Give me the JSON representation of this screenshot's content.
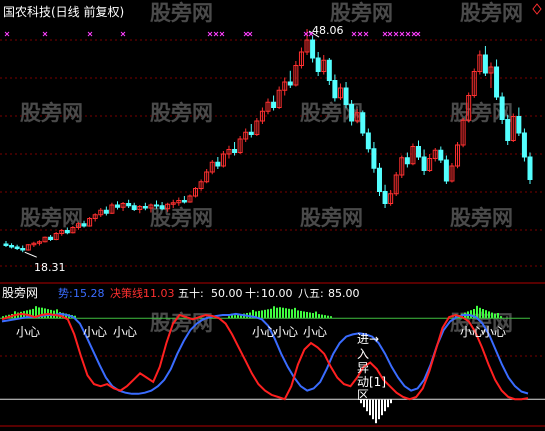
{
  "window": {
    "title": "国农科技(日线 前复权)",
    "corner_icon": "diamond-icon"
  },
  "watermark": "股旁网",
  "price_panel": {
    "high_label": "48.06",
    "low_label": "18.31"
  },
  "indicator_panel": {
    "name": "股旁网",
    "legend": [
      {
        "label": "势:",
        "value": "15.28",
        "color": "#3a6cff"
      },
      {
        "label": "决策线:",
        "value": "11.03",
        "color": "#ff3030"
      },
      {
        "label": "五十:",
        "value": "50.00",
        "color": "#ffffff"
      },
      {
        "label": "十:",
        "value": "10.00",
        "color": "#ffffff"
      },
      {
        "label": "八五:",
        "value": "85.00",
        "color": "#ffffff"
      }
    ],
    "annotations": [
      "小心",
      "小心",
      "小心",
      "小心",
      "小心",
      "小心",
      "小心",
      "小心"
    ],
    "signal_text": [
      "进→",
      "入",
      "异",
      "动[1]",
      "区"
    ]
  },
  "colors": {
    "up": "#ff3030",
    "down": "#54ffff",
    "grid": "#7a0000",
    "blue_line": "#3a6cff",
    "red_line": "#ff2020",
    "green_line": "#40c040",
    "green_bars": "#40ff40",
    "white": "#ffffff",
    "cross": "#ff40ff",
    "label": "#ffffff"
  },
  "chart_data": [
    {
      "type": "candlestick",
      "title": "国农科技(日线 前复权)",
      "y_range_approx": [
        17,
        49
      ],
      "annotated_high": 48.06,
      "annotated_low": 18.31,
      "candles_ohlc": [
        [
          19.4,
          19.8,
          19.0,
          19.2
        ],
        [
          19.2,
          19.5,
          18.8,
          19.0
        ],
        [
          19.0,
          19.3,
          18.6,
          18.8
        ],
        [
          18.8,
          19.2,
          18.31,
          18.6
        ],
        [
          18.6,
          19.4,
          18.5,
          19.3
        ],
        [
          19.3,
          19.7,
          19.0,
          19.5
        ],
        [
          19.5,
          19.9,
          19.2,
          19.7
        ],
        [
          19.7,
          20.4,
          19.6,
          20.3
        ],
        [
          20.3,
          20.6,
          19.8,
          20.0
        ],
        [
          20.0,
          21.0,
          19.9,
          20.8
        ],
        [
          20.8,
          21.4,
          20.5,
          21.2
        ],
        [
          21.2,
          21.6,
          20.7,
          20.9
        ],
        [
          20.9,
          21.8,
          20.8,
          21.6
        ],
        [
          21.6,
          22.3,
          21.3,
          22.1
        ],
        [
          22.1,
          22.5,
          21.6,
          21.8
        ],
        [
          21.8,
          23.0,
          21.7,
          22.8
        ],
        [
          22.8,
          23.5,
          22.4,
          23.3
        ],
        [
          23.3,
          24.2,
          23.0,
          23.9
        ],
        [
          23.9,
          24.4,
          23.2,
          23.5
        ],
        [
          23.5,
          24.9,
          23.4,
          24.6
        ],
        [
          24.6,
          25.1,
          24.0,
          24.3
        ],
        [
          24.3,
          25.0,
          23.8,
          24.8
        ],
        [
          24.8,
          25.3,
          24.2,
          24.5
        ],
        [
          24.5,
          24.9,
          23.8,
          24.0
        ],
        [
          24.0,
          24.6,
          23.5,
          24.4
        ],
        [
          24.4,
          24.9,
          23.9,
          24.2
        ],
        [
          24.2,
          24.8,
          23.6,
          24.6
        ],
        [
          24.6,
          25.2,
          24.1,
          24.5
        ],
        [
          24.5,
          25.0,
          23.9,
          24.1
        ],
        [
          24.1,
          24.9,
          23.7,
          24.7
        ],
        [
          24.7,
          25.3,
          24.2,
          24.9
        ],
        [
          24.9,
          25.6,
          24.5,
          25.2
        ],
        [
          25.2,
          25.8,
          24.8,
          25.0
        ],
        [
          25.0,
          26.0,
          24.9,
          25.8
        ],
        [
          25.8,
          27.0,
          25.6,
          26.8
        ],
        [
          26.8,
          28.0,
          26.5,
          27.7
        ],
        [
          27.7,
          29.4,
          27.5,
          29.0
        ],
        [
          29.0,
          30.6,
          28.7,
          30.3
        ],
        [
          30.3,
          31.0,
          29.4,
          29.8
        ],
        [
          29.8,
          31.8,
          29.6,
          31.4
        ],
        [
          31.4,
          32.5,
          30.8,
          32.0
        ],
        [
          32.0,
          33.0,
          31.2,
          31.6
        ],
        [
          31.6,
          33.8,
          31.4,
          33.4
        ],
        [
          33.4,
          34.8,
          33.0,
          34.3
        ],
        [
          34.3,
          35.4,
          33.6,
          34.0
        ],
        [
          34.0,
          36.2,
          33.8,
          35.8
        ],
        [
          35.8,
          37.6,
          35.4,
          37.1
        ],
        [
          37.1,
          38.8,
          36.7,
          38.3
        ],
        [
          38.3,
          39.2,
          37.2,
          37.6
        ],
        [
          37.6,
          40.4,
          37.4,
          39.9
        ],
        [
          39.9,
          41.6,
          39.2,
          41.0
        ],
        [
          41.0,
          42.5,
          40.2,
          40.6
        ],
        [
          40.6,
          43.8,
          40.4,
          43.2
        ],
        [
          43.2,
          45.6,
          42.8,
          45.0
        ],
        [
          45.0,
          48.06,
          44.6,
          46.6
        ],
        [
          46.6,
          47.2,
          43.6,
          44.2
        ],
        [
          44.2,
          45.0,
          41.8,
          42.4
        ],
        [
          42.4,
          44.6,
          42.0,
          43.9
        ],
        [
          43.9,
          44.2,
          40.6,
          41.2
        ],
        [
          41.2,
          42.0,
          38.4,
          38.9
        ],
        [
          38.9,
          40.8,
          38.6,
          40.2
        ],
        [
          40.2,
          41.0,
          37.5,
          38.0
        ],
        [
          38.0,
          38.6,
          35.2,
          35.8
        ],
        [
          35.8,
          37.4,
          35.5,
          36.9
        ],
        [
          36.9,
          37.2,
          33.8,
          34.2
        ],
        [
          34.2,
          34.8,
          31.6,
          32.1
        ],
        [
          32.1,
          33.0,
          28.9,
          29.5
        ],
        [
          29.5,
          30.2,
          25.8,
          26.4
        ],
        [
          26.4,
          27.3,
          24.2,
          24.8
        ],
        [
          24.8,
          26.6,
          24.5,
          26.1
        ],
        [
          26.1,
          29.0,
          25.8,
          28.6
        ],
        [
          28.6,
          31.2,
          28.2,
          30.9
        ],
        [
          30.9,
          31.6,
          29.6,
          30.1
        ],
        [
          30.1,
          32.8,
          29.9,
          32.4
        ],
        [
          32.4,
          33.2,
          30.6,
          31.0
        ],
        [
          31.0,
          32.0,
          28.6,
          29.2
        ],
        [
          29.2,
          31.4,
          29.0,
          30.8
        ],
        [
          30.8,
          32.2,
          30.4,
          31.9
        ],
        [
          31.9,
          32.4,
          30.2,
          30.6
        ],
        [
          30.6,
          31.2,
          27.4,
          27.8
        ],
        [
          27.8,
          30.2,
          27.6,
          29.8
        ],
        [
          29.8,
          33.0,
          29.5,
          32.6
        ],
        [
          32.6,
          36.2,
          32.3,
          35.9
        ],
        [
          35.9,
          39.6,
          35.6,
          39.2
        ],
        [
          39.2,
          42.8,
          38.9,
          42.4
        ],
        [
          42.4,
          45.2,
          42.0,
          44.6
        ],
        [
          44.6,
          45.8,
          41.8,
          42.2
        ],
        [
          42.2,
          43.6,
          40.2,
          43.0
        ],
        [
          43.0,
          44.0,
          38.6,
          39.0
        ],
        [
          39.0,
          39.6,
          35.4,
          36.0
        ],
        [
          36.0,
          36.6,
          32.6,
          33.2
        ],
        [
          33.2,
          36.8,
          33.0,
          36.4
        ],
        [
          36.4,
          37.6,
          33.8,
          34.2
        ],
        [
          34.2,
          34.8,
          30.4,
          31.0
        ],
        [
          31.0,
          31.6,
          27.4,
          28.0
        ]
      ]
    },
    {
      "type": "line",
      "name": "股旁网",
      "reference_levels": [
        10,
        50,
        85
      ],
      "series": [
        {
          "name": "势",
          "last_value": 15.28,
          "color": "#3a6cff",
          "values": [
            82,
            83,
            84,
            85,
            86,
            86,
            87,
            88,
            88,
            89,
            88,
            86,
            80,
            68,
            55,
            42,
            30,
            22,
            18,
            16,
            15,
            15,
            16,
            18,
            22,
            28,
            38,
            52,
            64,
            74,
            80,
            84,
            86,
            87,
            88,
            88,
            89,
            88,
            87,
            86,
            84,
            78,
            66,
            52,
            40,
            30,
            22,
            18,
            20,
            26,
            38,
            52,
            62,
            68,
            70,
            71,
            70,
            68,
            62,
            52,
            40,
            30,
            22,
            18,
            20,
            28,
            42,
            60,
            74,
            82,
            86,
            88,
            88,
            86,
            80,
            70,
            56,
            42,
            30,
            22,
            17,
            15.28
          ]
        },
        {
          "name": "决策线",
          "last_value": 11.03,
          "color": "#ff2020",
          "values": [
            84,
            86,
            88,
            89,
            88,
            86,
            88,
            89,
            88,
            87,
            84,
            70,
            50,
            32,
            24,
            22,
            24,
            20,
            18,
            22,
            28,
            34,
            30,
            26,
            40,
            62,
            80,
            88,
            86,
            84,
            86,
            88,
            87,
            85,
            80,
            70,
            58,
            46,
            34,
            24,
            18,
            14,
            12,
            10,
            22,
            42,
            56,
            62,
            58,
            52,
            40,
            30,
            24,
            22,
            30,
            40,
            44,
            38,
            28,
            22,
            16,
            12,
            10,
            12,
            20,
            36,
            56,
            76,
            86,
            88,
            86,
            82,
            72,
            58,
            42,
            28,
            18,
            12,
            10,
            10,
            11.03
          ]
        },
        {
          "name": "五十",
          "values": [
            50
          ]
        },
        {
          "name": "十",
          "values": [
            10
          ]
        },
        {
          "name": "八五",
          "values": [
            85
          ]
        }
      ]
    }
  ]
}
